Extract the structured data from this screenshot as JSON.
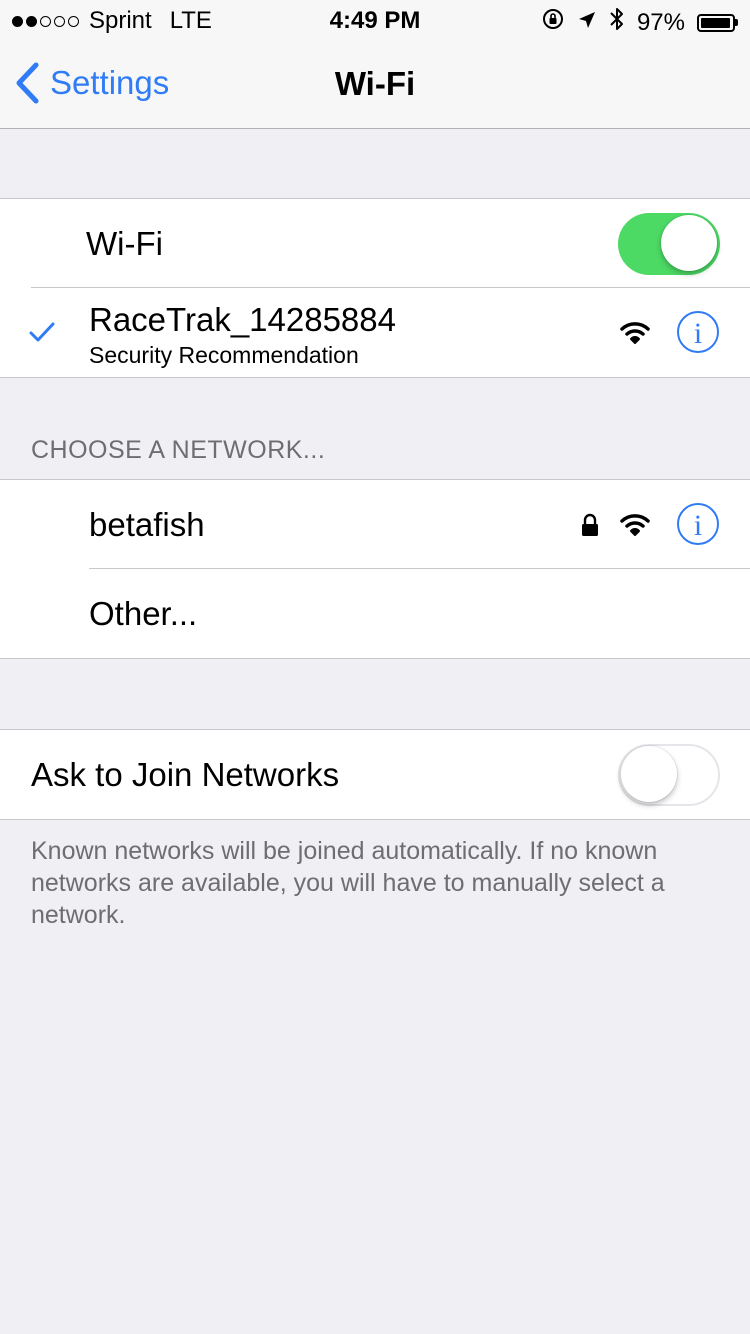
{
  "status_bar": {
    "signal_bars_filled": 2,
    "signal_bars_total": 5,
    "carrier": "Sprint",
    "network": "LTE",
    "time": "4:49 PM",
    "battery": "97%",
    "battery_level": 0.97
  },
  "nav": {
    "back_label": "Settings",
    "title": "Wi-Fi"
  },
  "wifi_toggle": {
    "label": "Wi-Fi",
    "state": "on",
    "on_color": "#4cd964"
  },
  "connected_network": {
    "name": "RaceTrak_14285884",
    "subtitle": "Security Recommendation",
    "checkmark_color": "#2f7cf6"
  },
  "choose_network": {
    "header": "CHOOSE A NETWORK...",
    "networks": [
      {
        "name": "betafish",
        "locked": true
      }
    ],
    "other_label": "Other..."
  },
  "ask_to_join": {
    "label": "Ask to Join Networks",
    "state": "off",
    "footer": "Known networks will be joined automatically. If no known networks are available, you will have to manually select a network."
  },
  "colors": {
    "accent": "#2f7cf6",
    "background": "#efeff4",
    "secondary_text": "#6d6d72"
  },
  "icons": {
    "info": "i"
  }
}
